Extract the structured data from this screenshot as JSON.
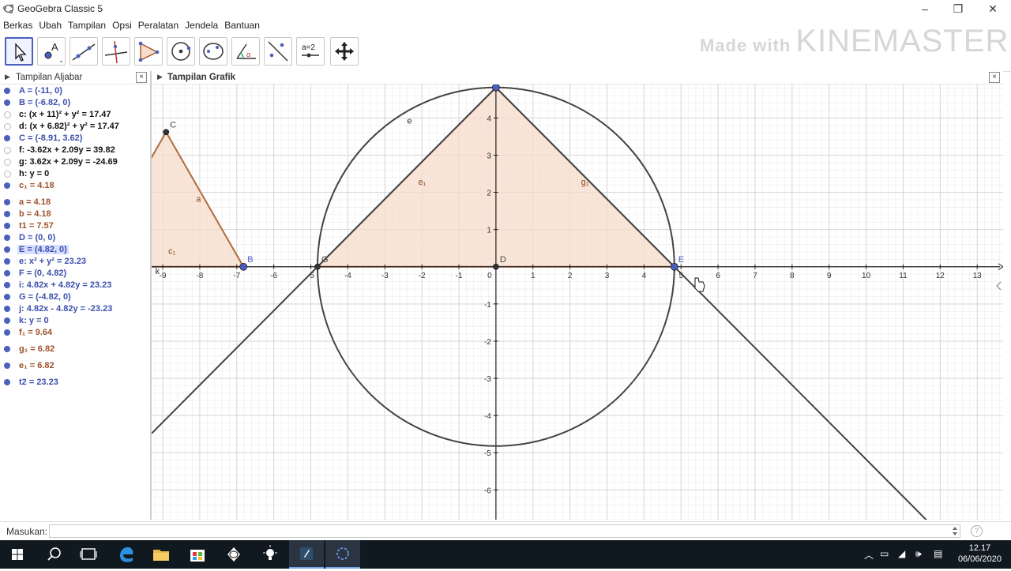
{
  "window": {
    "title": "GeoGebra Classic 5",
    "minimize": "–",
    "restore": "❐",
    "close": "✕"
  },
  "menu": [
    "Berkas",
    "Ubah",
    "Tampilan",
    "Opsi",
    "Peralatan",
    "Jendela",
    "Bantuan"
  ],
  "toolbar": {
    "tools": [
      "move",
      "point",
      "line",
      "perpendicular-line",
      "polygon",
      "circle",
      "conic",
      "angle",
      "reflect",
      "slider",
      "move-graphics-view"
    ],
    "slider_label": "a=2"
  },
  "watermark": {
    "made": "Made with",
    "brand": "KINEMASTER"
  },
  "algebra": {
    "title": "Tampilan Aljabar",
    "items": [
      {
        "text": "A = (-11, 0)",
        "color": "#4a5fbe",
        "kind": "point"
      },
      {
        "text": "B = (-6.82, 0)",
        "color": "#4a5fbe",
        "kind": "point"
      },
      {
        "text": "c: (x + 11)² + y² = 17.47",
        "color": "#cccccc",
        "kind": "hidden"
      },
      {
        "text": "d: (x + 6.82)² + y² = 17.47",
        "color": "#cccccc",
        "kind": "hidden"
      },
      {
        "text": "C = (-8.91, 3.62)",
        "color": "#4a5fbe",
        "kind": "point"
      },
      {
        "text": "f: -3.62x + 2.09y = 39.82",
        "color": "#cccccc",
        "kind": "hidden"
      },
      {
        "text": "g: 3.62x + 2.09y = -24.69",
        "color": "#cccccc",
        "kind": "hidden"
      },
      {
        "text": "h: y = 0",
        "color": "#cccccc",
        "kind": "hidden"
      },
      {
        "text": "c₁ = 4.18",
        "color": "#a0522d",
        "kind": "brown"
      },
      {
        "text": "a = 4.18",
        "color": "#a0522d",
        "kind": "brown"
      },
      {
        "text": "b = 4.18",
        "color": "#a0522d",
        "kind": "brown"
      },
      {
        "text": "t1 = 7.57",
        "color": "#a0522d",
        "kind": "brown"
      },
      {
        "text": "D = (0, 0)",
        "color": "#4a5fbe",
        "kind": "point"
      },
      {
        "text": "E = (4.82, 0)",
        "color": "#4a5fbe",
        "kind": "point"
      },
      {
        "text": "e: x² + y² = 23.23",
        "color": "#4a5fbe",
        "kind": "point"
      },
      {
        "text": "F = (0, 4.82)",
        "color": "#4a5fbe",
        "kind": "point"
      },
      {
        "text": "i: 4.82x + 4.82y = 23.23",
        "color": "#4a5fbe",
        "kind": "point"
      },
      {
        "text": "G = (-4.82, 0)",
        "color": "#4a5fbe",
        "kind": "point"
      },
      {
        "text": "j: 4.82x - 4.82y = -23.23",
        "color": "#4a5fbe",
        "kind": "point"
      },
      {
        "text": "k: y = 0",
        "color": "#4a5fbe",
        "kind": "point"
      },
      {
        "text": "f₁ = 9.64",
        "color": "#a0522d",
        "kind": "brown"
      },
      {
        "text": "g₁ = 6.82",
        "color": "#a0522d",
        "kind": "brown"
      },
      {
        "text": "e₁ = 6.82",
        "color": "#a0522d",
        "kind": "brown"
      },
      {
        "text": "t2 = 23.23",
        "color": "#4a5fbe",
        "kind": "point"
      }
    ],
    "selected_index": 13
  },
  "graphics": {
    "title": "Tampilan Grafik",
    "x_range": [
      -9.3,
      13.7
    ],
    "y_range": [
      -6.8,
      4.9
    ],
    "x_ticks": [
      -9,
      -8,
      -7,
      -6,
      -5,
      -4,
      -3,
      -2,
      -1,
      0,
      1,
      2,
      3,
      4,
      5,
      6,
      7,
      8,
      9,
      10,
      11,
      12,
      13
    ],
    "y_ticks": [
      -6,
      -5,
      -4,
      -3,
      -2,
      -1,
      1,
      2,
      3,
      4
    ],
    "x_tick_labels": [
      "-9",
      "-8",
      "-7",
      "-6",
      "-5",
      "-4",
      "-3",
      "-2",
      "-1",
      "0",
      "1",
      "2",
      "3",
      "4",
      "5",
      "6",
      "7",
      "8",
      "9",
      "10",
      "11",
      "12",
      "13"
    ],
    "y_tick_labels": [
      "-6",
      "-5",
      "-4",
      "-3",
      "-2",
      "-1",
      "1",
      "2",
      "3",
      "4"
    ],
    "circle": {
      "cx": 0,
      "cy": 0,
      "r": 4.82,
      "label": "e"
    },
    "triangle_left": {
      "points": [
        [
          -11,
          0
        ],
        [
          -6.82,
          0
        ],
        [
          -8.91,
          3.62
        ]
      ],
      "fill": "#f6dccb",
      "stroke": "#b06a3a"
    },
    "triangle_main": {
      "points": [
        [
          -4.82,
          0
        ],
        [
          4.82,
          0
        ],
        [
          0,
          4.82
        ]
      ],
      "fill": "#f6dccb",
      "stroke": "#b06a3a"
    },
    "lines": [
      {
        "name": "i",
        "x1": -9.3,
        "y1": -4.48,
        "x2": 0,
        "y2": 4.82
      },
      {
        "name": "j",
        "x1": 0,
        "y1": 4.82,
        "x2": 13.7,
        "y2": -8.88
      }
    ],
    "points": [
      {
        "label": "C",
        "x": -8.91,
        "y": 3.62,
        "color": "#333333"
      },
      {
        "label": "B",
        "x": -6.82,
        "y": 0,
        "color": "#4a5fbe"
      },
      {
        "label": "G",
        "x": -4.82,
        "y": 0,
        "color": "#333333"
      },
      {
        "label": "D",
        "x": 0,
        "y": 0,
        "color": "#333333"
      },
      {
        "label": "E",
        "x": 4.82,
        "y": 0,
        "color": "#4a5fbe"
      },
      {
        "label": "F",
        "x": 0,
        "y": 4.82,
        "color": "#4a5fbe"
      }
    ],
    "segment_labels": [
      {
        "label": "a",
        "x": -8.1,
        "y": 1.75
      },
      {
        "label": "c₁",
        "x": -8.85,
        "y": 0.35
      },
      {
        "label": "e₁",
        "x": -2.1,
        "y": 2.2
      },
      {
        "label": "g₁",
        "x": 2.3,
        "y": 2.2
      },
      {
        "label": "e",
        "x": -2.4,
        "y": 3.85
      },
      {
        "label": "k",
        "x": -9.2,
        "y": -0.2
      }
    ]
  },
  "input_bar": {
    "label": "Masukan:",
    "help": "?"
  },
  "taskbar": {
    "time": "12.17",
    "date": "06/06/2020"
  }
}
